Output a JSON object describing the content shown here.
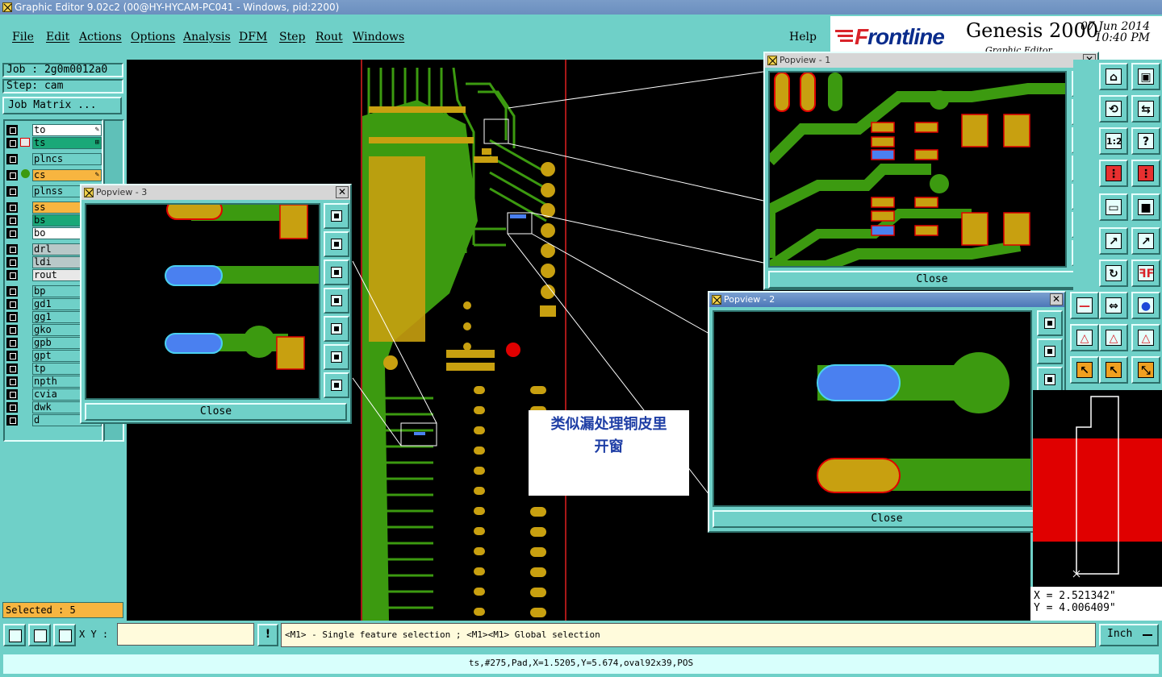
{
  "window": {
    "title": "Graphic Editor 9.02c2 (00@HY-HYCAM-PC041 - Windows, pid:2200)"
  },
  "menu": {
    "items": [
      "File",
      "Edit",
      "Actions",
      "Options",
      "Analysis",
      "DFM",
      "Step",
      "Rout",
      "Windows"
    ],
    "help": "Help"
  },
  "brand": {
    "logo_prefix": "F",
    "logo_rest": "rontline",
    "product": "Genesis 2000",
    "date": "07 Jun 2014",
    "time": "10:40 PM",
    "subtitle": "Graphic Editor"
  },
  "job": {
    "job_label": "Job : 2g0m0012a0",
    "step_label": "Step: cam",
    "matrix_button": "Job Matrix ..."
  },
  "layers": [
    {
      "name": "to",
      "color": "#ffffff",
      "mark": "pen"
    },
    {
      "name": "ts",
      "color": "#1aa878",
      "mark": "grid"
    },
    {
      "name": "plncs",
      "color": "#6fd0c8",
      "mark": ""
    },
    {
      "name": "cs",
      "color": "#f7b540",
      "mark": "pen"
    },
    {
      "name": "plnss",
      "color": "#6fd0c8",
      "mark": ""
    },
    {
      "name": "ss",
      "color": "#f7b540",
      "mark": ""
    },
    {
      "name": "bs",
      "color": "#1aa878",
      "mark": ""
    },
    {
      "name": "bo",
      "color": "#ffffff",
      "mark": ""
    },
    {
      "name": "drl",
      "color": "#b8c8c8",
      "mark": ""
    },
    {
      "name": "ldi",
      "color": "#b8c8c8",
      "mark": ""
    },
    {
      "name": "rout",
      "color": "#e8e8e8",
      "mark": ""
    },
    {
      "name": "bp",
      "color": "#6fd0c8",
      "mark": ""
    },
    {
      "name": "gd1",
      "color": "#6fd0c8",
      "mark": ""
    },
    {
      "name": "gg1",
      "color": "#6fd0c8",
      "mark": ""
    },
    {
      "name": "gko",
      "color": "#6fd0c8",
      "mark": ""
    },
    {
      "name": "gpb",
      "color": "#6fd0c8",
      "mark": ""
    },
    {
      "name": "gpt",
      "color": "#6fd0c8",
      "mark": ""
    },
    {
      "name": "tp",
      "color": "#6fd0c8",
      "mark": ""
    },
    {
      "name": "npth",
      "color": "#6fd0c8",
      "mark": ""
    },
    {
      "name": "cvia",
      "color": "#6fd0c8",
      "mark": ""
    },
    {
      "name": "dwk",
      "color": "#6fd0c8",
      "mark": ""
    },
    {
      "name": "d",
      "color": "#6fd0c8",
      "mark": ""
    }
  ],
  "selected": "Selected : 5",
  "popviews": {
    "p1": {
      "title": "Popview - 1",
      "close": "Close"
    },
    "p2": {
      "title": "Popview - 2",
      "close": "Close"
    },
    "p3": {
      "title": "Popview - 3",
      "close": "Close"
    }
  },
  "note": {
    "line1": "类似漏处理铜皮里",
    "line2": "开窗"
  },
  "coords": {
    "x": "X = 2.521342\"",
    "y": "Y = 4.006409\""
  },
  "bottom": {
    "xy_label": "X Y :",
    "xy_value": "",
    "alert": "!",
    "hint": "<M1> - Single feature selection ; <M1><M1> Global selection",
    "units": "Inch"
  },
  "status": "ts,#275,Pad,X=1.5205,Y=5.674,oval92x39,POS",
  "colors": {
    "panel": "#6fd0c8",
    "trace": "#3c9a10",
    "pad": "#c8a010",
    "selected": "#4a80f0",
    "outline": "#e00000"
  }
}
